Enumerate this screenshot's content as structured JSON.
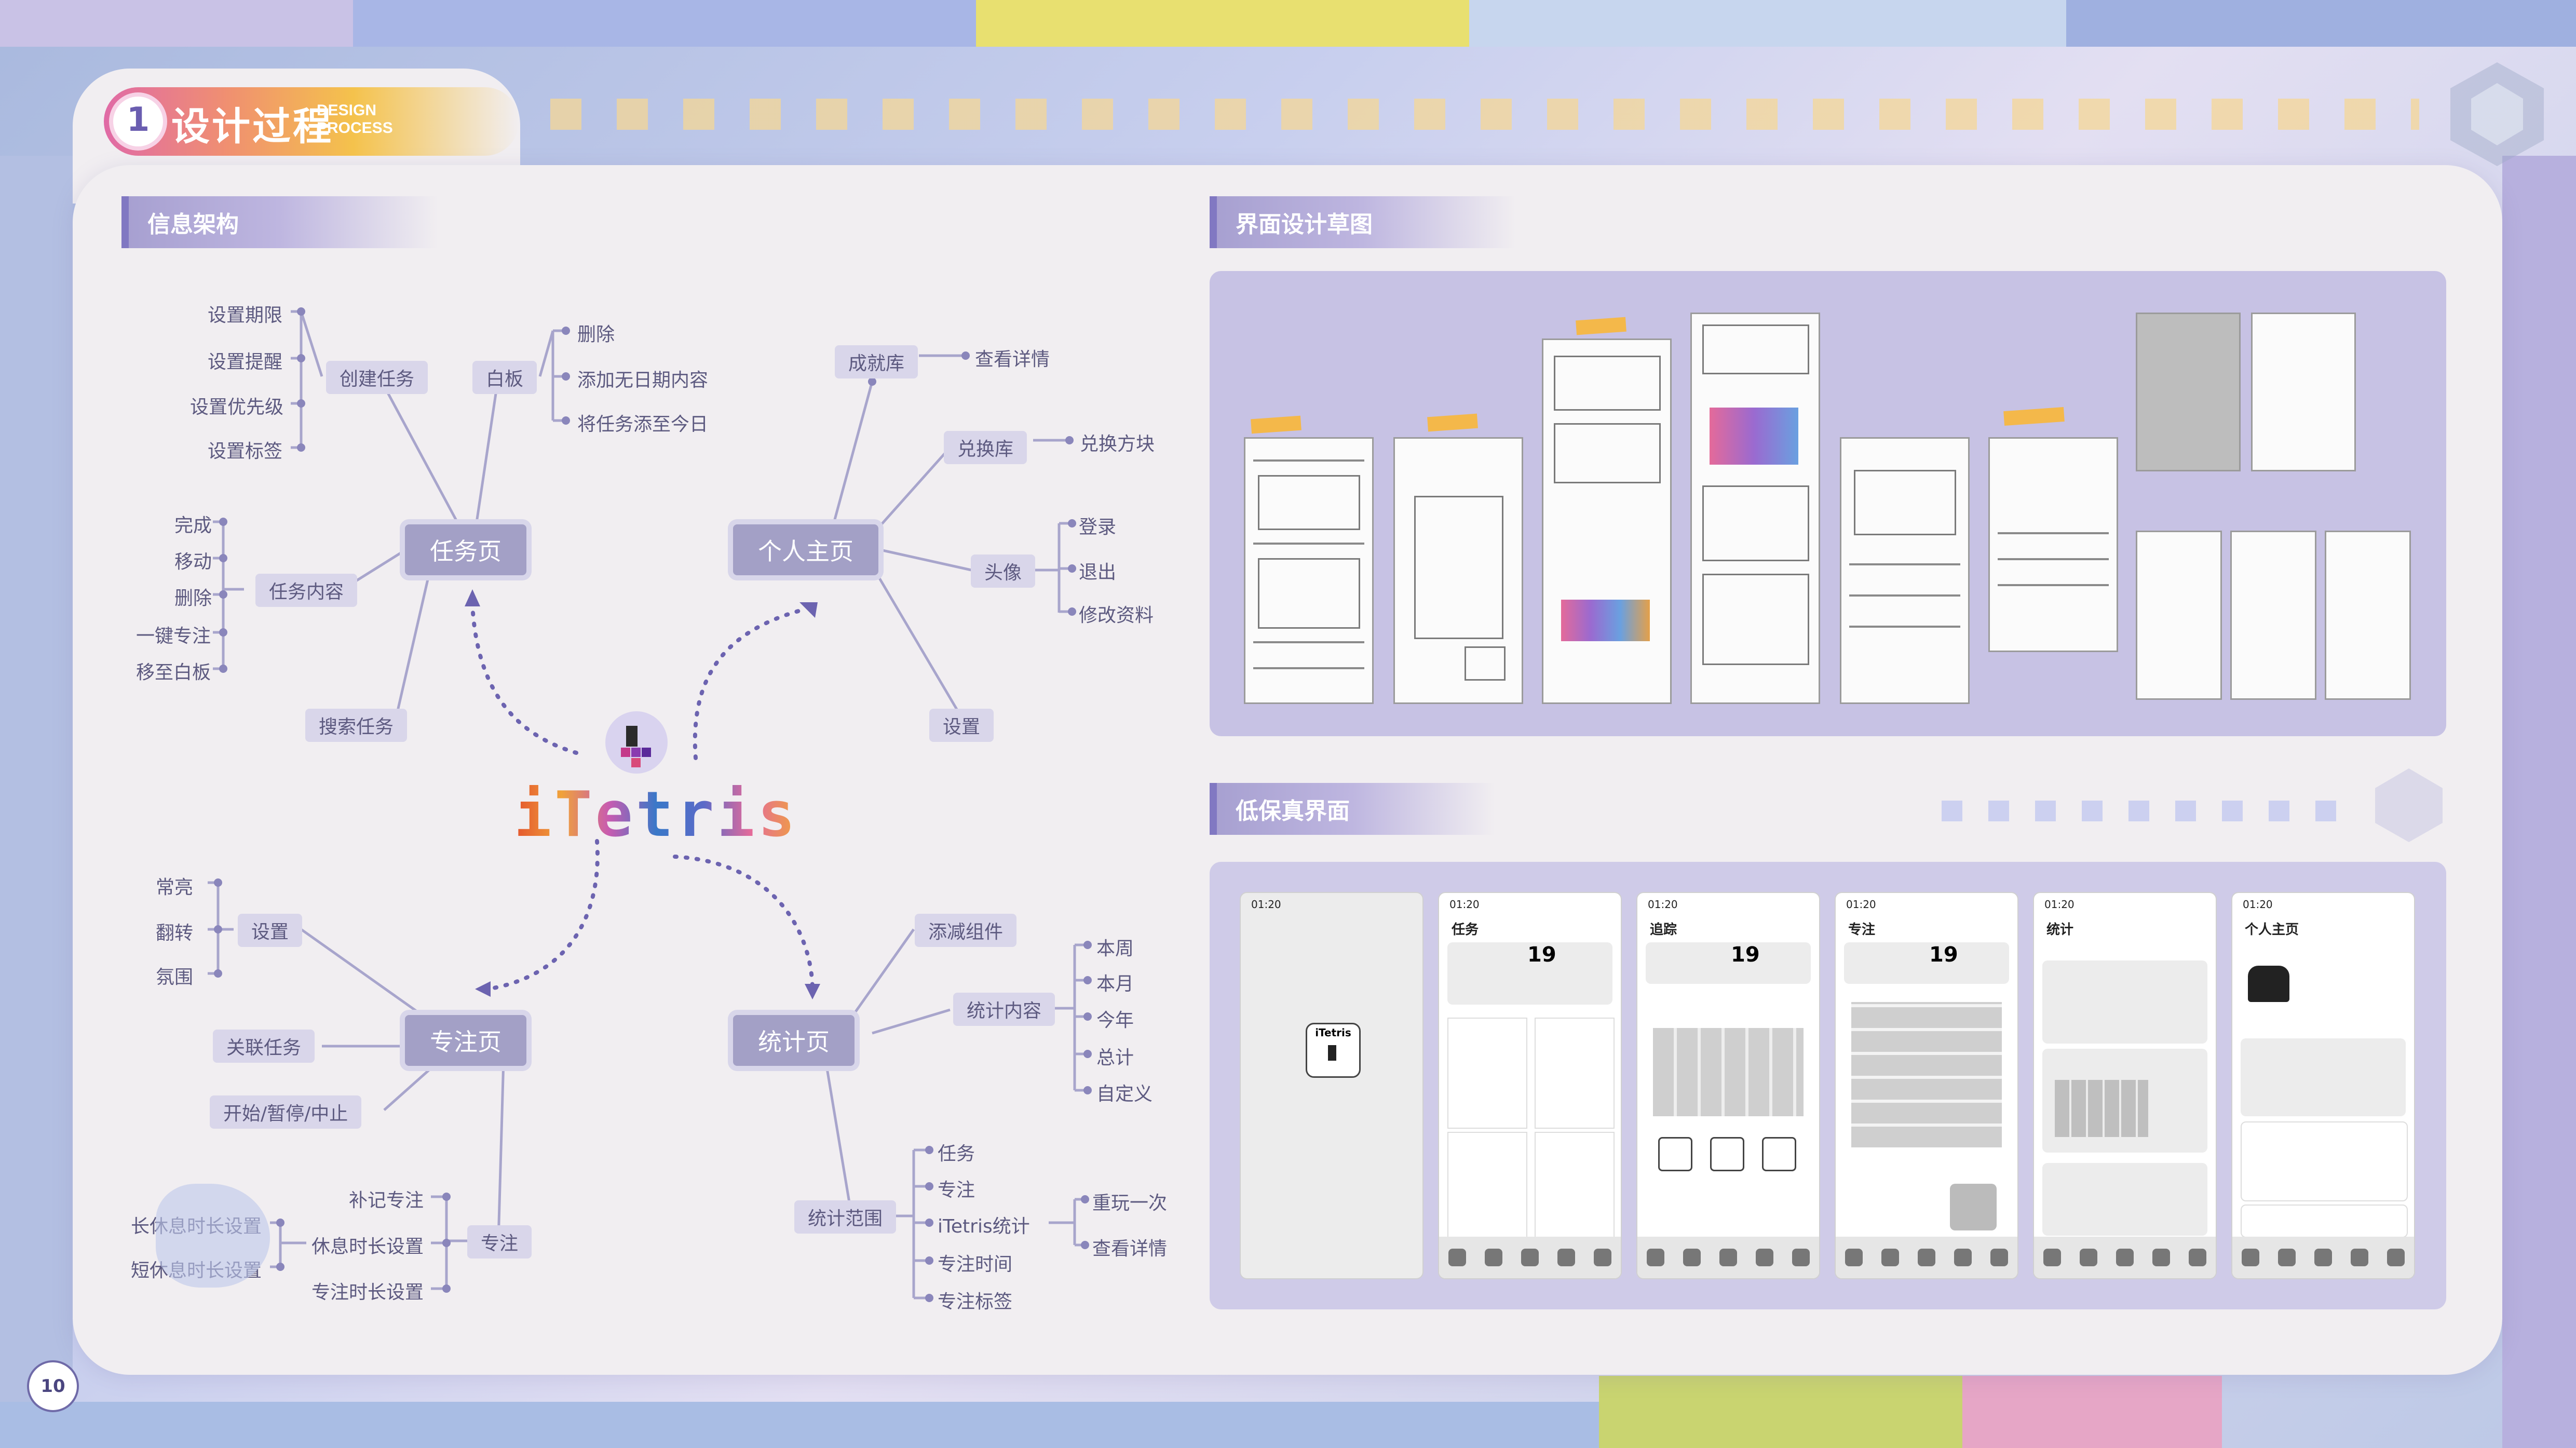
{
  "header": {
    "title_cn": "设计过程",
    "title_en_line1": "DESIGN",
    "title_en_line2": "PROCESS",
    "badge_number": "1"
  },
  "sections": {
    "info_architecture": "信息架构",
    "sketches": "界面设计草图",
    "lowfi": "低保真界面"
  },
  "mindmap": {
    "logo_text": "iTetris",
    "task_page": "任务页",
    "personal_page": "个人主页",
    "focus_page": "专注页",
    "stats_page": "统计页",
    "create_task": "创建任务",
    "create_children": [
      "设置期限",
      "设置提醒",
      "设置优先级",
      "设置标签"
    ],
    "whiteboard": "白板",
    "whiteboard_children": [
      "删除",
      "添加无日期内容",
      "将任务添至今日"
    ],
    "task_content": "任务内容",
    "task_content_children": [
      "完成",
      "移动",
      "删除",
      "一键专注",
      "移至白板"
    ],
    "search_task": "搜索任务",
    "achievement": "成就库",
    "view_detail": "查看详情",
    "exchange": "兑换库",
    "exchange_block": "兑换方块",
    "avatar": "头像",
    "avatar_children": [
      "登录",
      "退出",
      "修改资料"
    ],
    "settings": "设置",
    "focus_settings": "设置",
    "focus_settings_children": [
      "常亮",
      "翻转",
      "氛围"
    ],
    "link_task": "关联任务",
    "start_pause": "开始/暂停/中止",
    "focus": "专注",
    "focus_children": [
      "补记专注",
      "休息时长设置",
      "专注时长设置"
    ],
    "rest_children": [
      "长休息时长设置",
      "短休息时长设置"
    ],
    "add_widget": "添减组件",
    "stat_content": "统计内容",
    "stat_content_children": [
      "本周",
      "本月",
      "今年",
      "总计",
      "自定义"
    ],
    "stat_range": "统计范围",
    "stat_range_children": [
      "任务",
      "专注",
      "iTetris统计",
      "专注时间",
      "专注标签"
    ],
    "itetris_children": [
      "重玩一次",
      "查看详情"
    ]
  },
  "lowfi_screens": [
    {
      "title": "",
      "label": "iTetris"
    },
    {
      "title": "任务",
      "date": "19"
    },
    {
      "title": "追踪",
      "date": "19"
    },
    {
      "title": "专注",
      "date": "19"
    },
    {
      "title": "统计",
      "date": ""
    },
    {
      "title": "个人主页",
      "date": ""
    }
  ],
  "status_time": "01:20",
  "page_number": "10",
  "colors": {
    "accent": "#8178c2",
    "node_bg": "#a3a0c6",
    "panel": "#c7c2e4"
  }
}
